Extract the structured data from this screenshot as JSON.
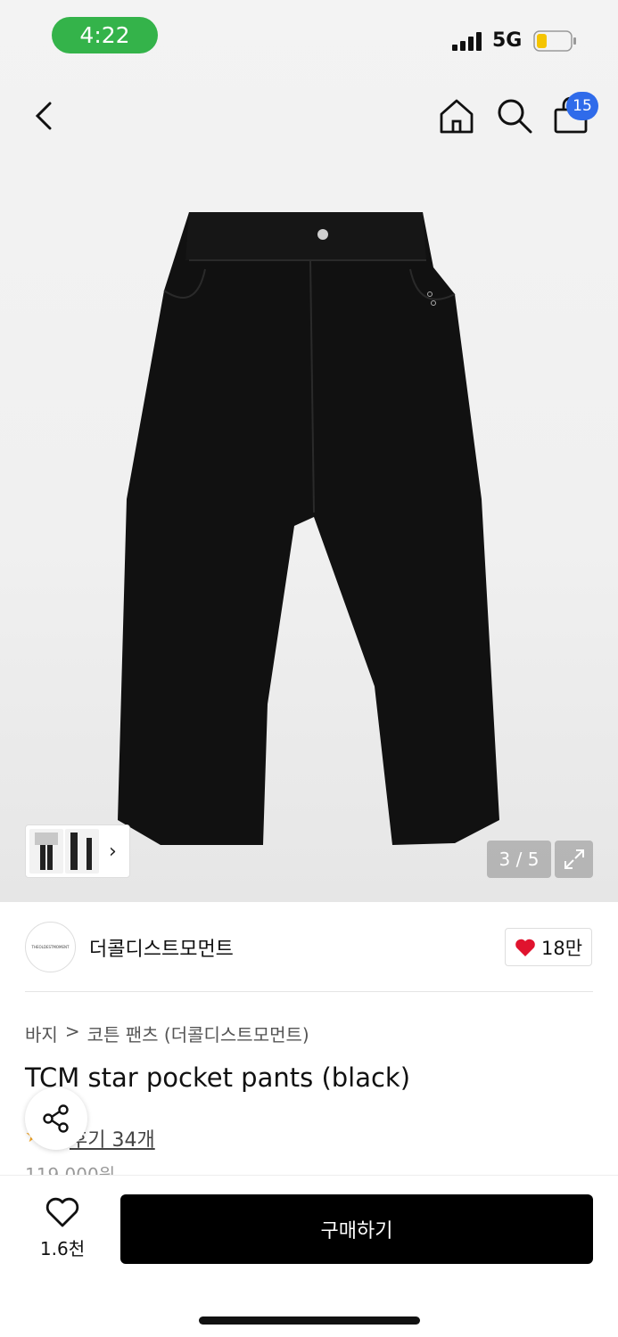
{
  "status_bar": {
    "time": "4:22",
    "network": "5G"
  },
  "nav": {
    "cart_count": "15"
  },
  "gallery": {
    "counter": "3 / 5"
  },
  "brand": {
    "logo_text": "THEOLDESTMOMENT",
    "name": "더콜디스트모먼트",
    "likes": "18만"
  },
  "breadcrumb": {
    "category": "바지",
    "separator": ">",
    "subcategory": "코튼 팬츠 (더콜디스트모먼트)"
  },
  "product": {
    "title": "TCM star pocket pants (black)",
    "review_link": "후기 34개",
    "price_partial": "119,000원"
  },
  "bottom": {
    "wish_count": "1.6천",
    "buy_label": "구매하기"
  },
  "colors": {
    "status_green": "#34b34a",
    "badge_blue": "#2f6bea",
    "heart_red": "#e0132e",
    "buy_black": "#000000"
  }
}
